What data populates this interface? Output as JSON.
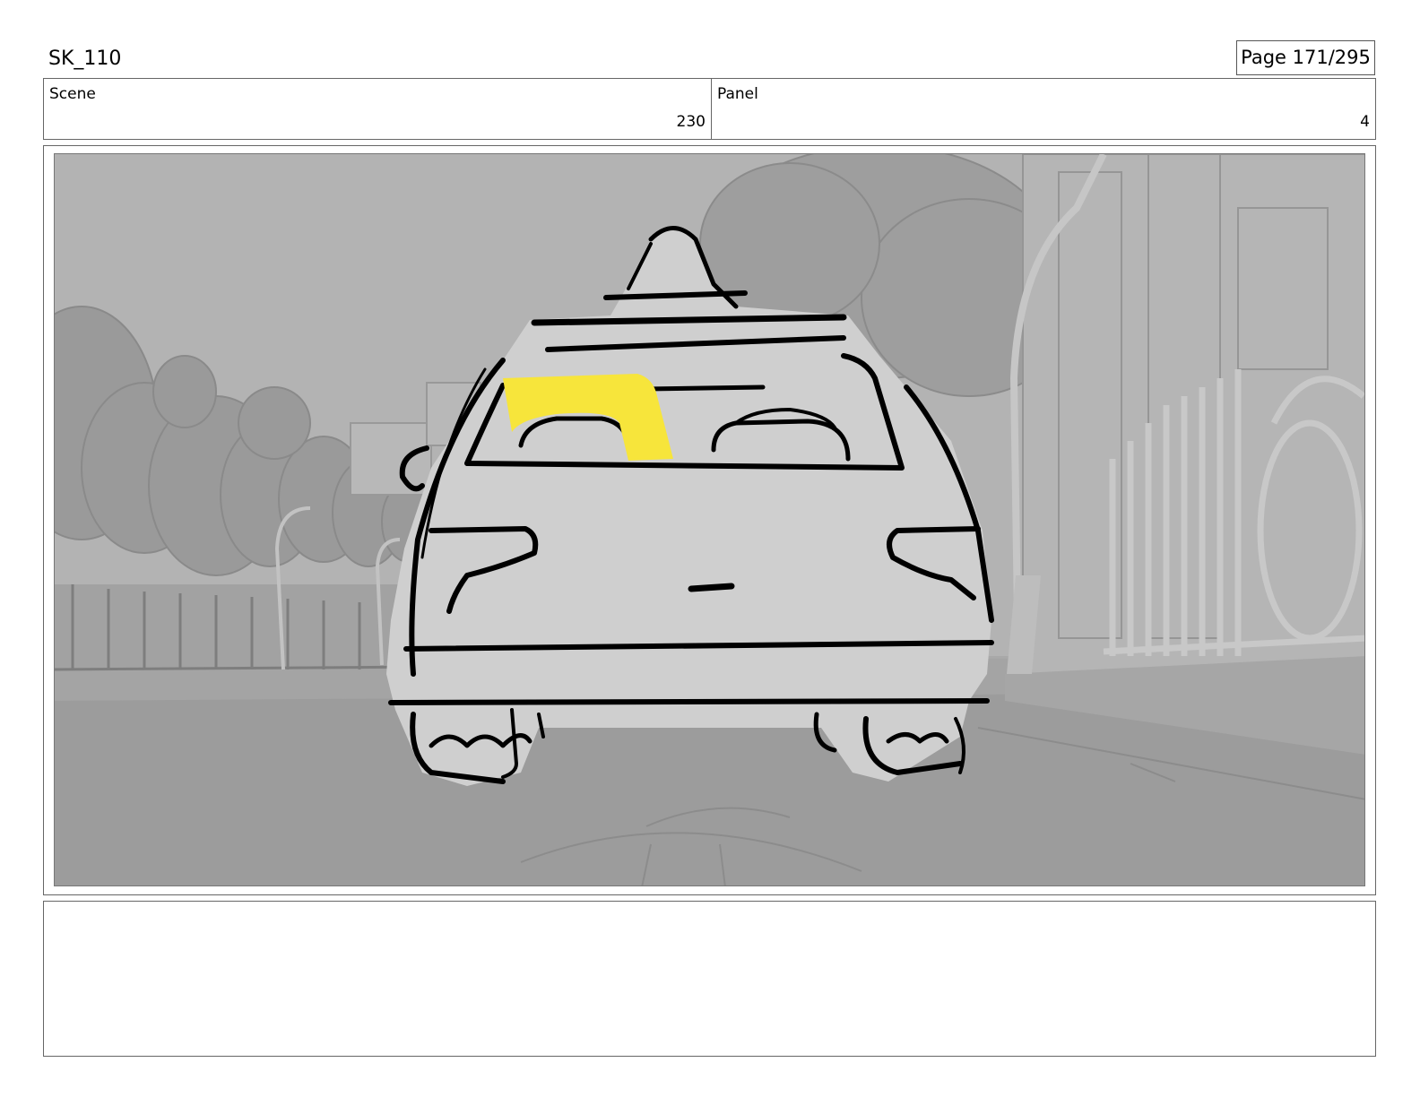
{
  "header": {
    "doc_id": "SK_110",
    "page_label": "Page 171/295"
  },
  "info": {
    "scene_label": "Scene",
    "scene_value": "230",
    "panel_label": "Panel",
    "panel_value": "4"
  },
  "frame": {
    "highlight_color": "#f7e53b",
    "sketch_fill": "#cfcfcf",
    "background_gray": "#a9a9a9"
  },
  "notes": {
    "text": ""
  }
}
